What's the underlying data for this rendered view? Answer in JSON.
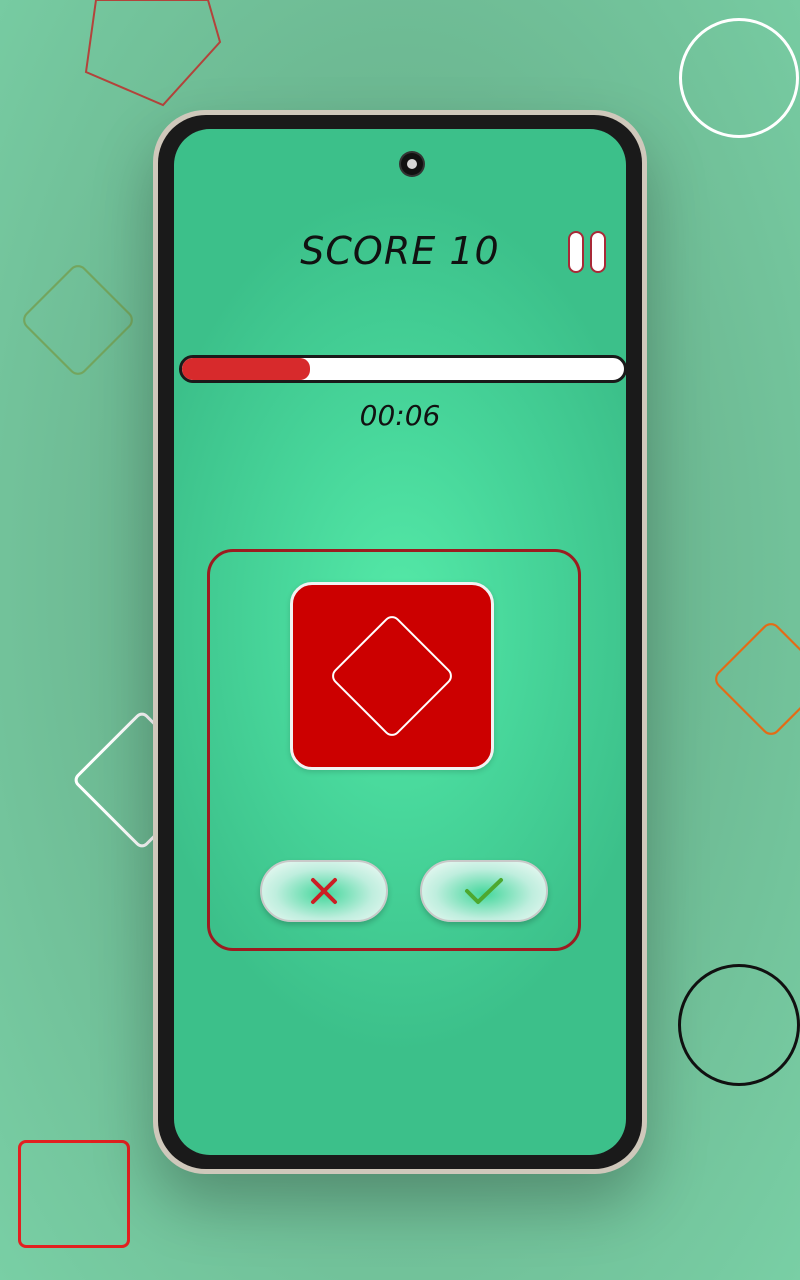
{
  "game": {
    "score_text": "SCORE 10",
    "timer": "00:06",
    "timer_progress": 0.29
  },
  "shape": {
    "name": "diamond",
    "tile_color": "#cc0000",
    "outline_color": "#ffffff"
  },
  "buttons": {
    "no_icon": "close-icon",
    "yes_icon": "checkmark-icon"
  },
  "colors": {
    "accent_red": "#d72a2c",
    "accent_green": "#4fd79b",
    "border_dark_red": "#9c1c20"
  }
}
